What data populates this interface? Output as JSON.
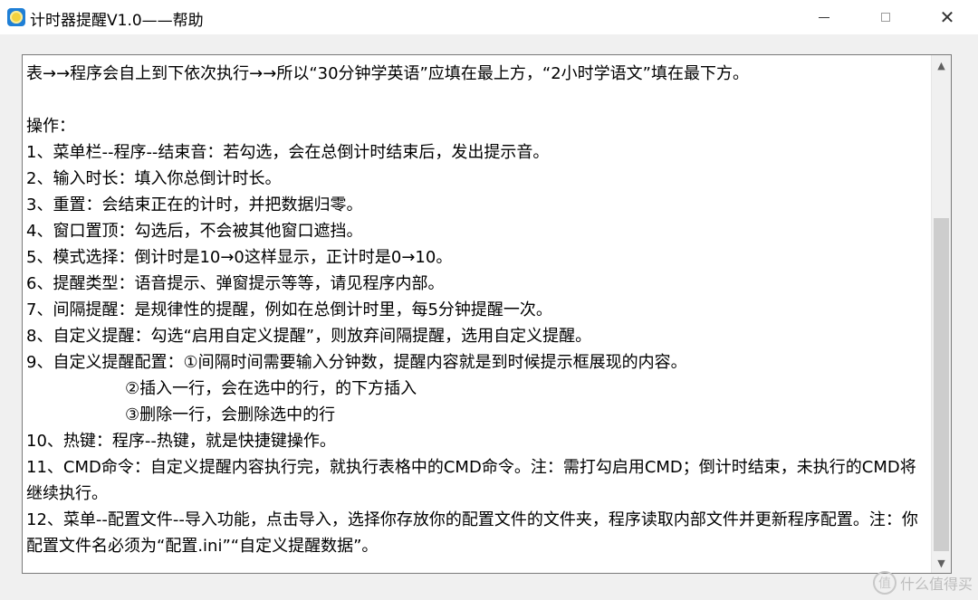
{
  "window": {
    "title": "计时器提醒V1.0——帮助",
    "controls": {
      "minimize": "minimize",
      "maximize": "maximize",
      "close": "✕"
    }
  },
  "help_text": {
    "lines": [
      "表→→程序会自上到下依次执行→→所以“30分钟学英语”应填在最上方，“2小时学语文”填在最下方。",
      "",
      "操作：",
      "1、菜单栏--程序--结束音：若勾选，会在总倒计时结束后，发出提示音。",
      "2、输入时长：填入你总倒计时长。",
      "3、重置：会结束正在的计时，并把数据归零。",
      "4、窗口置顶：勾选后，不会被其他窗口遮挡。",
      "5、模式选择：倒计时是10→0这样显示，正计时是0→10。",
      "6、提醒类型：语音提示、弹窗提示等等，请见程序内部。",
      "7、间隔提醒：是规律性的提醒，例如在总倒计时里，每5分钟提醒一次。",
      "8、自定义提醒：勾选“启用自定义提醒”，则放弃间隔提醒，选用自定义提醒。",
      "9、自定义提醒配置：①间隔时间需要输入分钟数，提醒内容就是到时候提示框展现的内容。",
      "②插入一行，会在选中的行，的下方插入",
      "③删除一行，会删除选中的行",
      "10、热键：程序--热键，就是快捷键操作。",
      "11、CMD命令：自定义提醒内容执行完，就执行表格中的CMD命令。注：需打勾启用CMD；倒计时结束，未执行的CMD将继续执行。",
      "12、菜单--配置文件--导入功能，点击导入，选择你存放你的配置文件的文件夹，程序读取内部文件并更新程序配置。注：你配置文件名必须为“配置.ini”“自定义提醒数据”。"
    ]
  },
  "scrollbar": {
    "up": "▲",
    "down": "▼",
    "position": 0.3
  },
  "watermark": {
    "logo": "值",
    "text": "什么值得买"
  },
  "colors": {
    "titlebar": "#ffffff",
    "background": "#f0f0f0",
    "panel": "#ffffff",
    "border": "#7a7a7a",
    "thumb": "#cdcdcd"
  }
}
